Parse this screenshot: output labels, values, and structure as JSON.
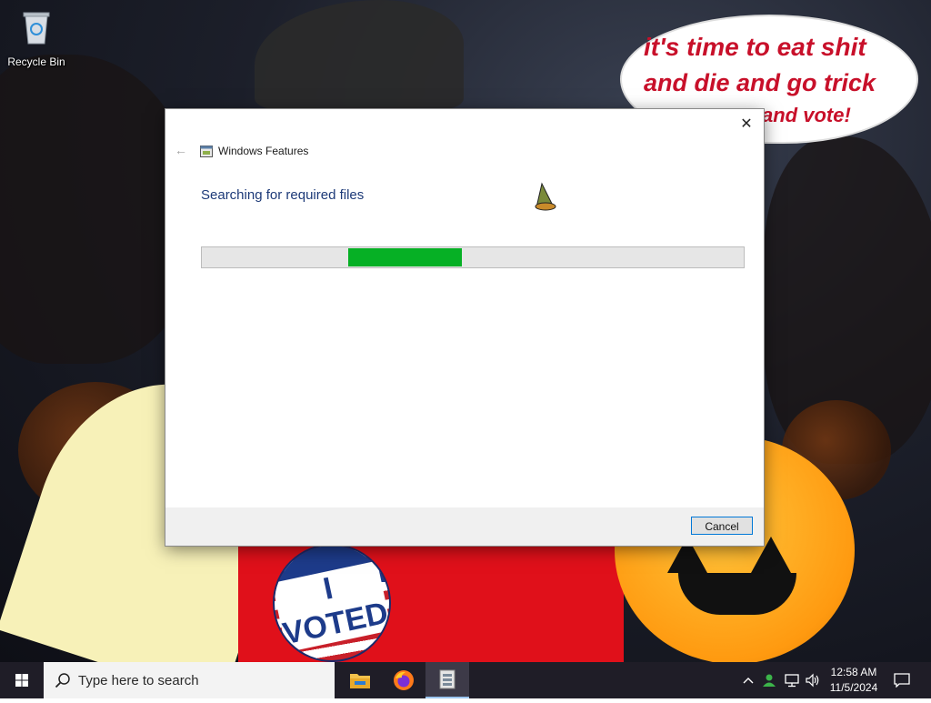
{
  "desktop": {
    "recycle_bin_label": "Recycle Bin",
    "wallpaper_speech_line1": "it's time to eat shit",
    "wallpaper_speech_line2": "and die and go trick",
    "wallpaper_speech_line3": "and vote!",
    "wallpaper_badge_text": "I VOTED"
  },
  "dialog": {
    "app_title": "Windows Features",
    "heading": "Searching for required files",
    "progress_segment_start": 0.27,
    "progress_segment_width": 0.21,
    "cancel_label": "Cancel",
    "close_icon": "close-icon",
    "back_icon": "back-arrow-icon"
  },
  "taskbar": {
    "search_placeholder": "Type here to search",
    "apps": [
      "file-explorer",
      "firefox",
      "windows-features"
    ],
    "clock_time": "12:58 AM",
    "clock_date": "11/5/2024"
  },
  "colors": {
    "progress_fill": "#06b025",
    "heading": "#1d3a78",
    "accent": "#0078d7",
    "taskbar": "#1f1d27"
  }
}
